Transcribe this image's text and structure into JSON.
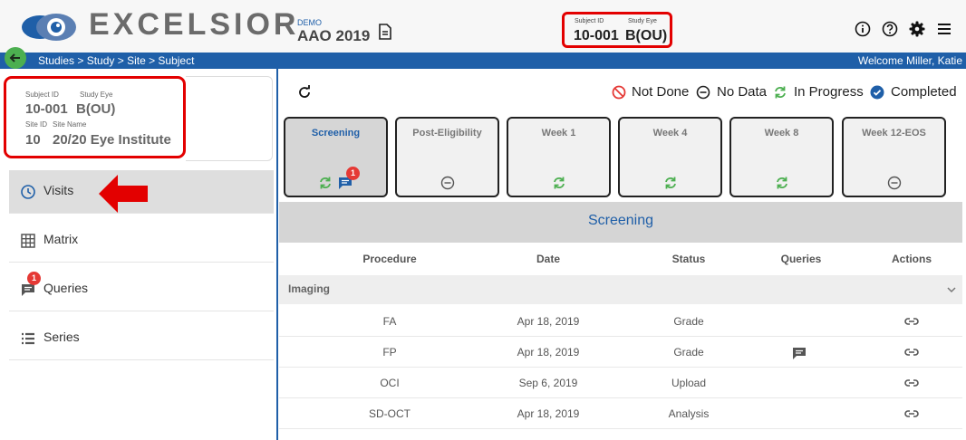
{
  "header": {
    "logo_text": "EXCELSIOR",
    "demo_label": "DEMO",
    "study_name": "AAO 2019",
    "subject_id_label": "Subject ID",
    "study_eye_label": "Study Eye",
    "subject_id": "10-001",
    "study_eye": "B(OU)",
    "icons": [
      "info-icon",
      "help-icon",
      "gear-icon",
      "menu-icon"
    ]
  },
  "breadcrumb": "Studies > Study > Site > Subject",
  "welcome": "Welcome Miller, Katie",
  "subject_card": {
    "subject_id_label": "Subject ID",
    "study_eye_label": "Study Eye",
    "subject_id": "10-001",
    "study_eye": "B(OU)",
    "site_id_label": "Site ID",
    "site_name_label": "Site Name",
    "site_id": "10",
    "site_name": "20/20 Eye Institute"
  },
  "nav": {
    "visits": "Visits",
    "matrix": "Matrix",
    "queries": "Queries",
    "queries_badge": "1",
    "series": "Series"
  },
  "legend": {
    "not_done": "Not Done",
    "no_data": "No Data",
    "in_progress": "In Progress",
    "completed": "Completed"
  },
  "visits": [
    {
      "label": "Screening",
      "status": "in-progress",
      "queries": "1"
    },
    {
      "label": "Post-Eligibility",
      "status": "no-data"
    },
    {
      "label": "Week 1",
      "status": "in-progress"
    },
    {
      "label": "Week 4",
      "status": "in-progress"
    },
    {
      "label": "Week 8",
      "status": "in-progress"
    },
    {
      "label": "Week 12-EOS",
      "status": "no-data"
    }
  ],
  "selected_visit": "Screening",
  "table": {
    "headers": {
      "procedure": "Procedure",
      "date": "Date",
      "status": "Status",
      "queries": "Queries",
      "actions": "Actions"
    },
    "group": "Imaging",
    "rows": [
      {
        "procedure": "FA",
        "date": "Apr 18, 2019",
        "status": "Grade",
        "has_query": false
      },
      {
        "procedure": "FP",
        "date": "Apr 18, 2019",
        "status": "Grade",
        "has_query": true
      },
      {
        "procedure": "OCI",
        "date": "Sep 6, 2019",
        "status": "Upload",
        "has_query": false
      },
      {
        "procedure": "SD-OCT",
        "date": "Apr 18, 2019",
        "status": "Analysis",
        "has_query": false
      }
    ]
  },
  "colors": {
    "brand_blue": "#1f5fa8",
    "highlight_red": "#e30000",
    "progress_green": "#4caf50"
  }
}
